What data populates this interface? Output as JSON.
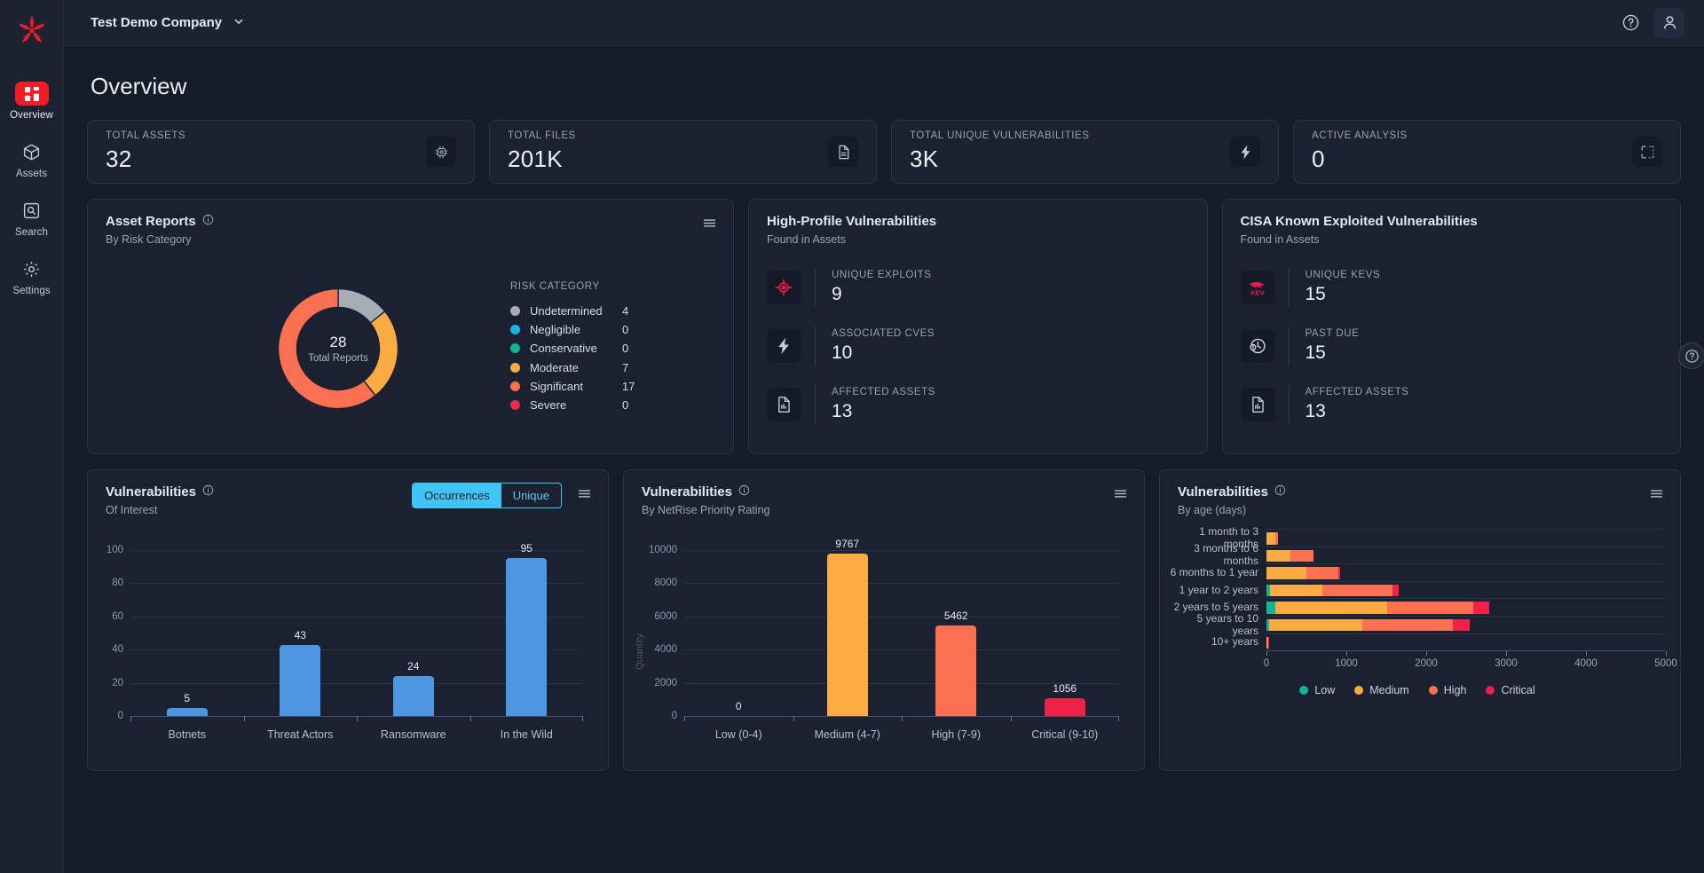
{
  "brand": {
    "logo_name": "netrise-logo",
    "accent": "#f31b24"
  },
  "sidebar": {
    "items": [
      {
        "label": "Overview",
        "icon": "grid-icon",
        "active": true
      },
      {
        "label": "Assets",
        "icon": "cube-icon",
        "active": false
      },
      {
        "label": "Search",
        "icon": "search-box-icon",
        "active": false
      },
      {
        "label": "Settings",
        "icon": "gear-icon",
        "active": false
      }
    ]
  },
  "topbar": {
    "company": "Test Demo Company",
    "chevron": "chevron-down-icon",
    "help_icon": "help-circle-icon",
    "account_icon": "user-icon"
  },
  "page": {
    "title": "Overview"
  },
  "stats": [
    {
      "label": "TOTAL ASSETS",
      "value": "32",
      "icon": "cpu-chip-icon"
    },
    {
      "label": "TOTAL FILES",
      "value": "201K",
      "icon": "file-document-icon"
    },
    {
      "label": "TOTAL UNIQUE VULNERABILITIES",
      "value": "3K",
      "icon": "lightning-bolt-icon"
    },
    {
      "label": "ACTIVE ANALYSIS",
      "value": "0",
      "icon": "scan-frame-icon"
    }
  ],
  "asset_reports": {
    "title": "Asset Reports",
    "subtitle": "By Risk Category",
    "info_icon": "info-icon",
    "menu_icon": "hamburger-menu-icon",
    "center_value": "28",
    "center_label": "Total Reports",
    "legend_title": "RISK CATEGORY"
  },
  "high_profile": {
    "title": "High-Profile Vulnerabilities",
    "subtitle": "Found in Assets",
    "items": [
      {
        "label": "UNIQUE EXPLOITS",
        "value": "9",
        "icon": "crosshair-target-icon"
      },
      {
        "label": "ASSOCIATED CVES",
        "value": "10",
        "icon": "lightning-bolt-icon"
      },
      {
        "label": "AFFECTED ASSETS",
        "value": "13",
        "icon": "report-chart-icon"
      }
    ]
  },
  "cisa_kev": {
    "title": "CISA Known Exploited Vulnerabilities",
    "subtitle": "Found in Assets",
    "items": [
      {
        "label": "UNIQUE KEVS",
        "value": "15",
        "icon": "kev-shark-icon"
      },
      {
        "label": "PAST DUE",
        "value": "15",
        "icon": "clock-alert-icon"
      },
      {
        "label": "AFFECTED ASSETS",
        "value": "13",
        "icon": "report-chart-icon"
      }
    ]
  },
  "vuln_interest": {
    "title": "Vulnerabilities",
    "subtitle": "Of Interest",
    "info_icon": "info-icon",
    "menu_icon": "hamburger-menu-icon",
    "toggle": {
      "options": [
        "Occurrences",
        "Unique"
      ],
      "selected": "Occurrences"
    }
  },
  "vuln_npr": {
    "title": "Vulnerabilities",
    "subtitle": "By NetRise Priority Rating",
    "info_icon": "info-icon",
    "menu_icon": "hamburger-menu-icon"
  },
  "vuln_age": {
    "title": "Vulnerabilities",
    "subtitle": "By age (days)",
    "info_icon": "info-icon",
    "menu_icon": "hamburger-menu-icon"
  },
  "help_fab": {
    "icon": "help-circle-icon"
  },
  "chart_data": [
    {
      "id": "asset_reports_donut",
      "type": "pie",
      "title": "Asset Reports",
      "subtitle": "By Risk Category",
      "legend_title": "RISK CATEGORY",
      "center_value": 28,
      "center_label": "Total Reports",
      "legend_position": "right",
      "categories": [
        "Undetermined",
        "Negligible",
        "Conservative",
        "Moderate",
        "Significant",
        "Severe"
      ],
      "values": [
        4,
        0,
        0,
        7,
        17,
        0
      ],
      "colors": [
        "#a7adb4",
        "#17b6e0",
        "#12b397",
        "#fbab42",
        "#fb7050",
        "#ef2a4f"
      ]
    },
    {
      "id": "vulnerabilities_of_interest",
      "type": "bar",
      "title": "Vulnerabilities",
      "subtitle": "Of Interest",
      "xlabel": "",
      "ylabel": "",
      "ylim": [
        0,
        100
      ],
      "yticks": [
        0,
        20,
        40,
        60,
        80,
        100
      ],
      "grid": true,
      "categories": [
        "Botnets",
        "Threat Actors",
        "Ransomware",
        "In the Wild"
      ],
      "values": [
        5,
        43,
        24,
        95
      ],
      "color": "#4e96e2"
    },
    {
      "id": "vulnerabilities_by_npr",
      "type": "bar",
      "title": "Vulnerabilities",
      "subtitle": "By NetRise Priority Rating",
      "xlabel": "",
      "ylabel": "Quantity",
      "ylim": [
        0,
        10000
      ],
      "yticks": [
        0,
        2000,
        4000,
        6000,
        8000,
        10000
      ],
      "grid": true,
      "categories": [
        "Low (0-4)",
        "Medium (4-7)",
        "High (7-9)",
        "Critical (9-10)"
      ],
      "values": [
        0,
        9767,
        5462,
        1056
      ],
      "colors": [
        "#fbab42",
        "#fbab42",
        "#fb7050",
        "#ee2147"
      ]
    },
    {
      "id": "vulnerabilities_by_age",
      "type": "bar",
      "orientation": "horizontal",
      "stacked": true,
      "title": "Vulnerabilities",
      "subtitle": "By age (days)",
      "xlim": [
        0,
        5000
      ],
      "xticks": [
        0,
        1000,
        2000,
        3000,
        4000,
        5000
      ],
      "legend_position": "bottom",
      "categories": [
        "1 month to 3 months",
        "3 months to 6 months",
        "6 months to 1 year",
        "1 year to 2 years",
        "2 years to 5 years",
        "5 years to 10 years",
        "10+ years"
      ],
      "series": [
        {
          "name": "Low",
          "color": "#12b397",
          "values": [
            0,
            0,
            0,
            40,
            110,
            30,
            0
          ]
        },
        {
          "name": "Medium",
          "color": "#fbab42",
          "values": [
            110,
            305,
            495,
            660,
            1400,
            1170,
            12
          ]
        },
        {
          "name": "High",
          "color": "#fb7050",
          "values": [
            35,
            285,
            400,
            880,
            1080,
            1130,
            10
          ]
        },
        {
          "name": "Critical",
          "color": "#ee2147",
          "values": [
            0,
            0,
            25,
            80,
            200,
            215,
            8
          ]
        }
      ]
    }
  ]
}
